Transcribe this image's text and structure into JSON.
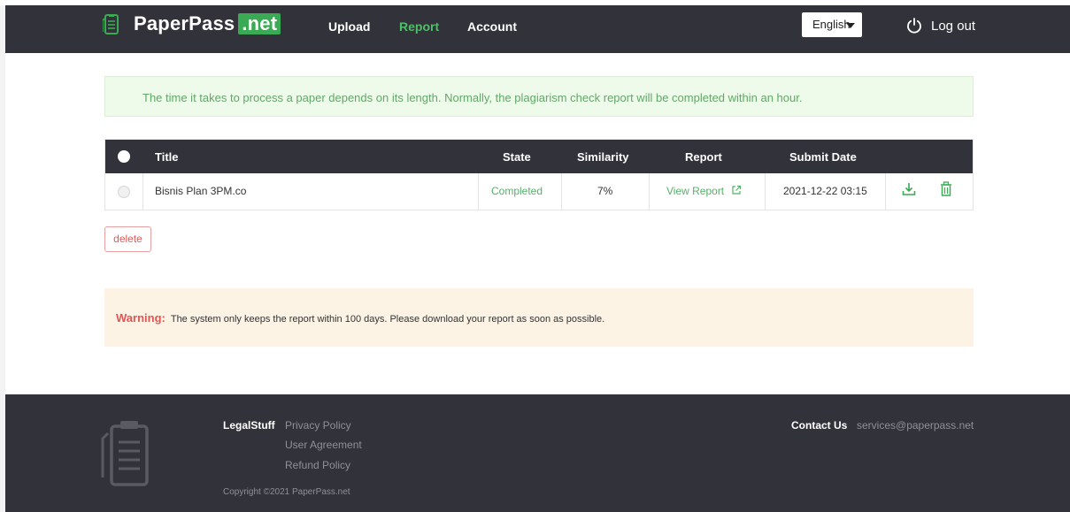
{
  "header": {
    "brand": "PaperPass",
    "brand_suffix": ".net",
    "nav": [
      {
        "label": "Upload"
      },
      {
        "label": "Report"
      },
      {
        "label": "Account"
      }
    ],
    "language": "English",
    "logout_label": "Log out"
  },
  "notice": "The time it takes to process a paper depends on its length. Normally, the plagiarism check report will be completed within an hour.",
  "table": {
    "headers": {
      "title": "Title",
      "state": "State",
      "similarity": "Similarity",
      "report": "Report",
      "submit_date": "Submit Date"
    },
    "rows": [
      {
        "title": "Bisnis Plan 3PM.co",
        "state": "Completed",
        "similarity": "7%",
        "report": "View Report",
        "submit_date": "2021-12-22 03:15"
      }
    ]
  },
  "delete_label": "delete",
  "warning": {
    "label": "Warning:",
    "text": "The system only keeps the report within 100 days. Please download your report as soon as possible."
  },
  "footer": {
    "legal_title": "LegalStuff",
    "legal_links": [
      "Privacy Policy",
      "User Agreement",
      "Refund Policy"
    ],
    "copyright": "Copyright ©2021 PaperPass.net",
    "contact_title": "Contact Us",
    "contact_email": "services@paperpass.net"
  },
  "colors": {
    "header_bg": "#32323a",
    "accent_green": "#3aaa54",
    "notice_bg": "#eefaea",
    "warning_bg": "#fcf3e5",
    "danger": "#e05b5b"
  },
  "icons": [
    "document-logo-icon",
    "power-icon",
    "caret-down-icon",
    "external-link-icon",
    "download-icon",
    "trash-icon",
    "footer-document-icon"
  ]
}
